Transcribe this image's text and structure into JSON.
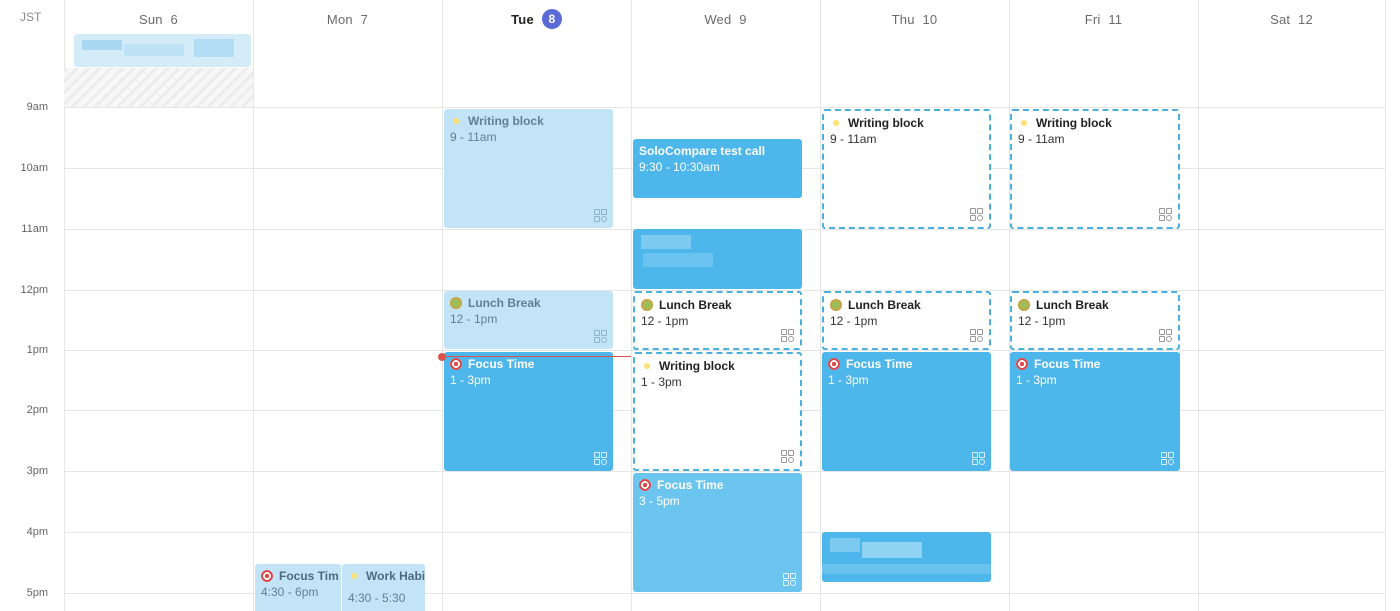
{
  "timezone_label": "JST",
  "days": [
    {
      "dow": "Sun",
      "num": "6"
    },
    {
      "dow": "Mon",
      "num": "7"
    },
    {
      "dow": "Tue",
      "num": "8",
      "today": true
    },
    {
      "dow": "Wed",
      "num": "9"
    },
    {
      "dow": "Thu",
      "num": "10"
    },
    {
      "dow": "Fri",
      "num": "11"
    },
    {
      "dow": "Sat",
      "num": "12"
    }
  ],
  "hours": [
    "9am",
    "10am",
    "11am",
    "12pm",
    "1pm",
    "2pm",
    "3pm",
    "4pm",
    "5pm"
  ],
  "events": {
    "tue_writing": {
      "title": "Writing block",
      "time": "9 - 11am"
    },
    "tue_lunch": {
      "title": "Lunch Break",
      "time": "12 - 1pm"
    },
    "tue_focus": {
      "title": "Focus Time",
      "time": "1 - 3pm"
    },
    "wed_solo": {
      "title": "SoloCompare test call",
      "time": "9:30 - 10:30am"
    },
    "wed_lunch": {
      "title": "Lunch Break",
      "time": "12 - 1pm"
    },
    "wed_writing": {
      "title": "Writing block",
      "time": "1 - 3pm"
    },
    "wed_focus": {
      "title": "Focus Time",
      "time": "3 - 5pm"
    },
    "thu_writing": {
      "title": "Writing block",
      "time": "9 - 11am"
    },
    "thu_lunch": {
      "title": "Lunch Break",
      "time": "12 - 1pm"
    },
    "thu_focus": {
      "title": "Focus Time",
      "time": "1 - 3pm"
    },
    "fri_writing": {
      "title": "Writing block",
      "time": "9 - 11am"
    },
    "fri_lunch": {
      "title": "Lunch Break",
      "time": "12 - 1pm"
    },
    "fri_focus": {
      "title": "Focus Time",
      "time": "1 - 3pm"
    },
    "mon_focus": {
      "title": "Focus Tim",
      "time": "4:30 - 6pm"
    },
    "mon_habit": {
      "title": "Work Habi",
      "time": "4:30 - 5:30"
    }
  },
  "colors": {
    "today_badge": "#5a6bd8",
    "event_solid": "#4db6ea",
    "event_pale": "#c2e4f6",
    "event_dashed_border": "#4ab0de",
    "now_indicator": "#d9534f"
  },
  "icons": {
    "writing": "sparkles-icon",
    "lunch": "salad-icon",
    "focus": "target-icon",
    "sub": "shapes-icon"
  }
}
